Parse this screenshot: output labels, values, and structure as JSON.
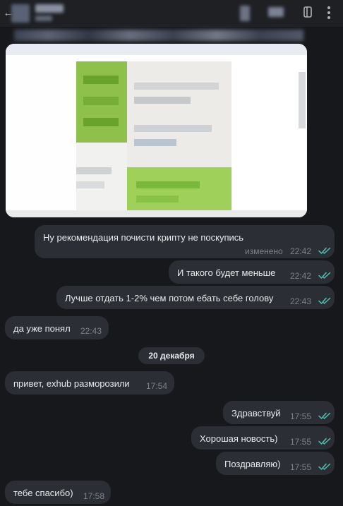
{
  "header": {
    "back_icon": "arrow-left-icon",
    "menu_icon": "kebab-menu-icon",
    "sidebar_icon": "sidebar-toggle-icon"
  },
  "colors": {
    "background": "#17181c",
    "bubble": "#2b2e34",
    "check_accent": "#4fc3b5",
    "meta_text": "#7d8189"
  },
  "messages": [
    {
      "direction": "out",
      "text": "Ну рекомендация почисти крипту не поскупись",
      "edited_label": "изменено",
      "time": "22:42",
      "read": true
    },
    {
      "direction": "out",
      "text": "И такого будет меньше",
      "time": "22:42",
      "read": true
    },
    {
      "direction": "out",
      "text": "Лучше отдать 1-2% чем потом ебать себе голову",
      "time": "22:43",
      "read": true
    },
    {
      "direction": "in",
      "text": "да уже понял",
      "time": "22:43"
    },
    {
      "direction": "in",
      "text": "привет, exhub разморозили",
      "time": "17:54"
    },
    {
      "direction": "out",
      "text": "Здравствуй",
      "time": "17:55",
      "read": true
    },
    {
      "direction": "out",
      "text": "Хорошая новость)",
      "time": "17:55",
      "read": true
    },
    {
      "direction": "out",
      "text": "Поздравляю)",
      "time": "17:55",
      "read": true
    },
    {
      "direction": "in",
      "text": "тебе спасибо)",
      "time": "17:58"
    }
  ],
  "date_separator": "20 декабря"
}
